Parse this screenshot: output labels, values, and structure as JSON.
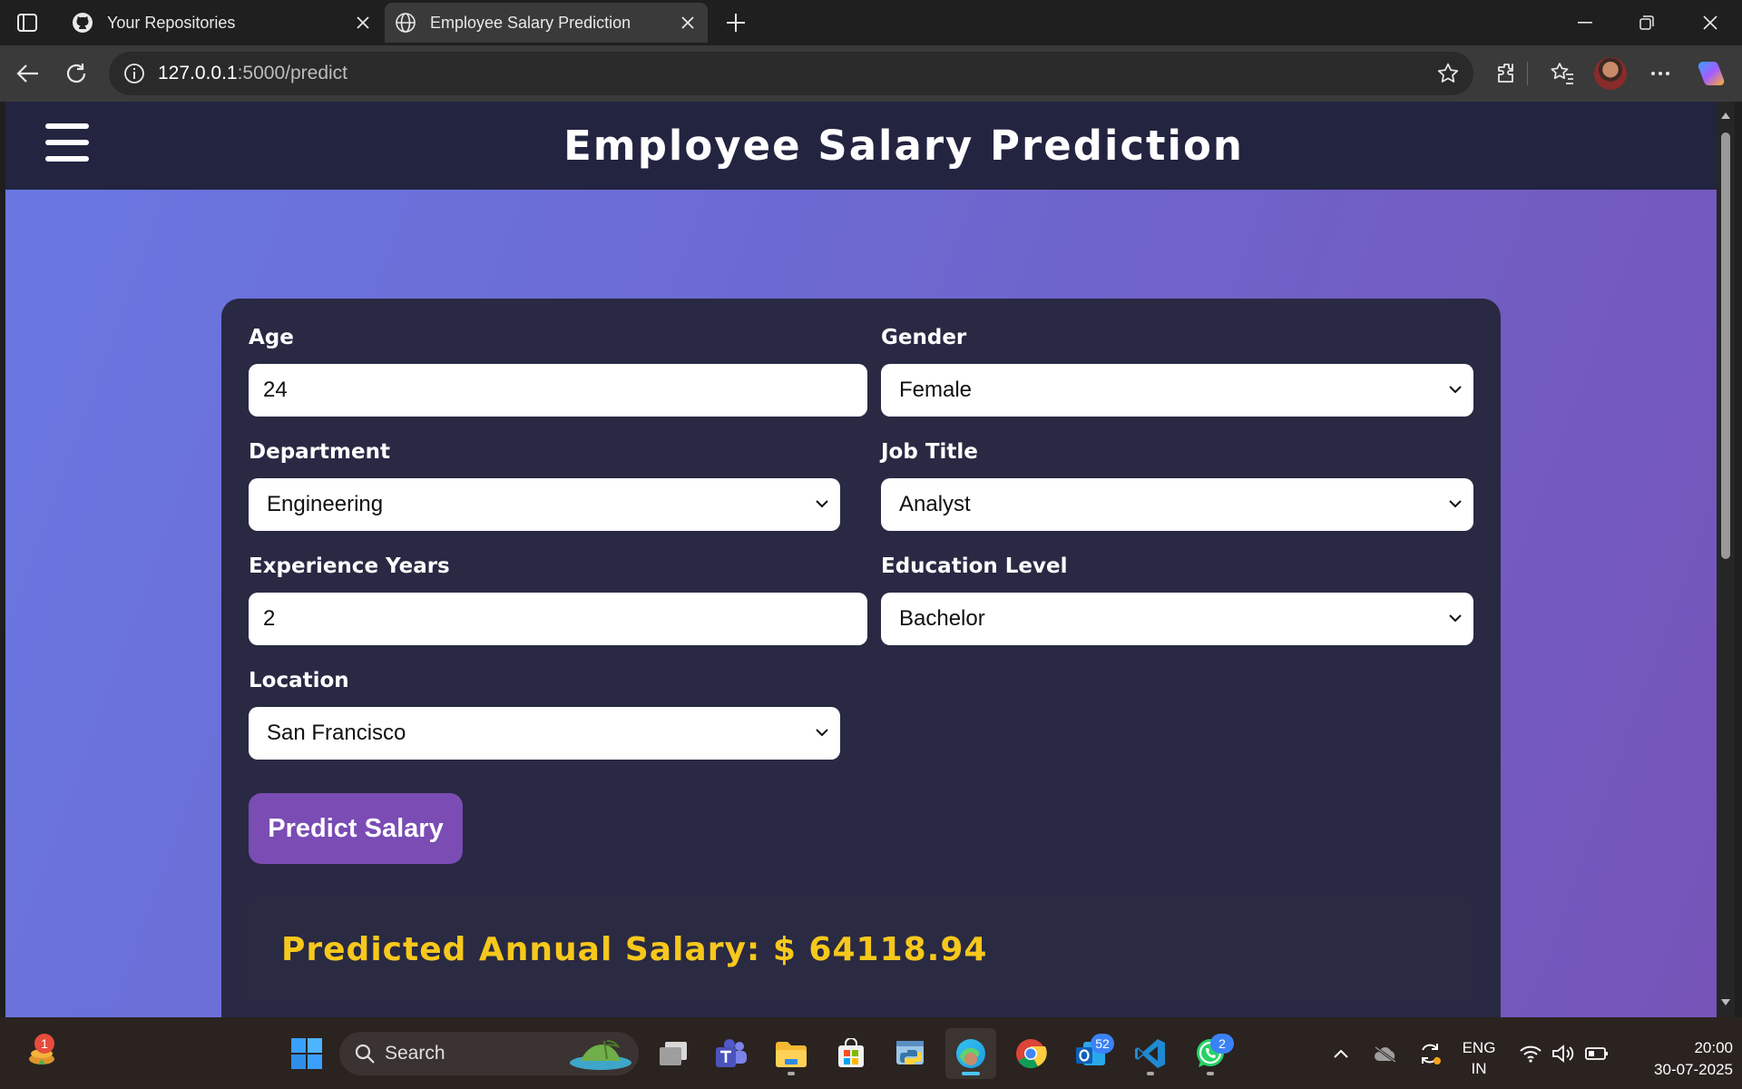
{
  "browser": {
    "tabs": [
      {
        "title": "Your Repositories",
        "active": false,
        "favicon": "github-icon"
      },
      {
        "title": "Employee Salary Prediction",
        "active": true,
        "favicon": "globe-icon"
      }
    ],
    "url_host": "127.0.0.1",
    "url_rest": ":5000/predict"
  },
  "app": {
    "title": "Employee Salary Prediction",
    "form": {
      "age": {
        "label": "Age",
        "value": "24"
      },
      "gender": {
        "label": "Gender",
        "value": "Female"
      },
      "department": {
        "label": "Department",
        "value": "Engineering"
      },
      "job_title": {
        "label": "Job Title",
        "value": "Analyst"
      },
      "experience": {
        "label": "Experience Years",
        "value": "2"
      },
      "education": {
        "label": "Education Level",
        "value": "Bachelor"
      },
      "location": {
        "label": "Location",
        "value": "San Francisco"
      }
    },
    "predict_button": "Predict Salary",
    "result": "Predicted Annual Salary: $ 64118.94",
    "colors": {
      "header": "#222440",
      "card": "#292944",
      "button": "#7a4cb4",
      "result_text": "#f7c81c"
    }
  },
  "taskbar": {
    "search_label": "Search",
    "badges": {
      "widgets": "1",
      "outlook": "52",
      "whatsapp": "2"
    },
    "lang_line1": "ENG",
    "lang_line2": "IN",
    "time": "20:00",
    "date": "30-07-2025"
  }
}
